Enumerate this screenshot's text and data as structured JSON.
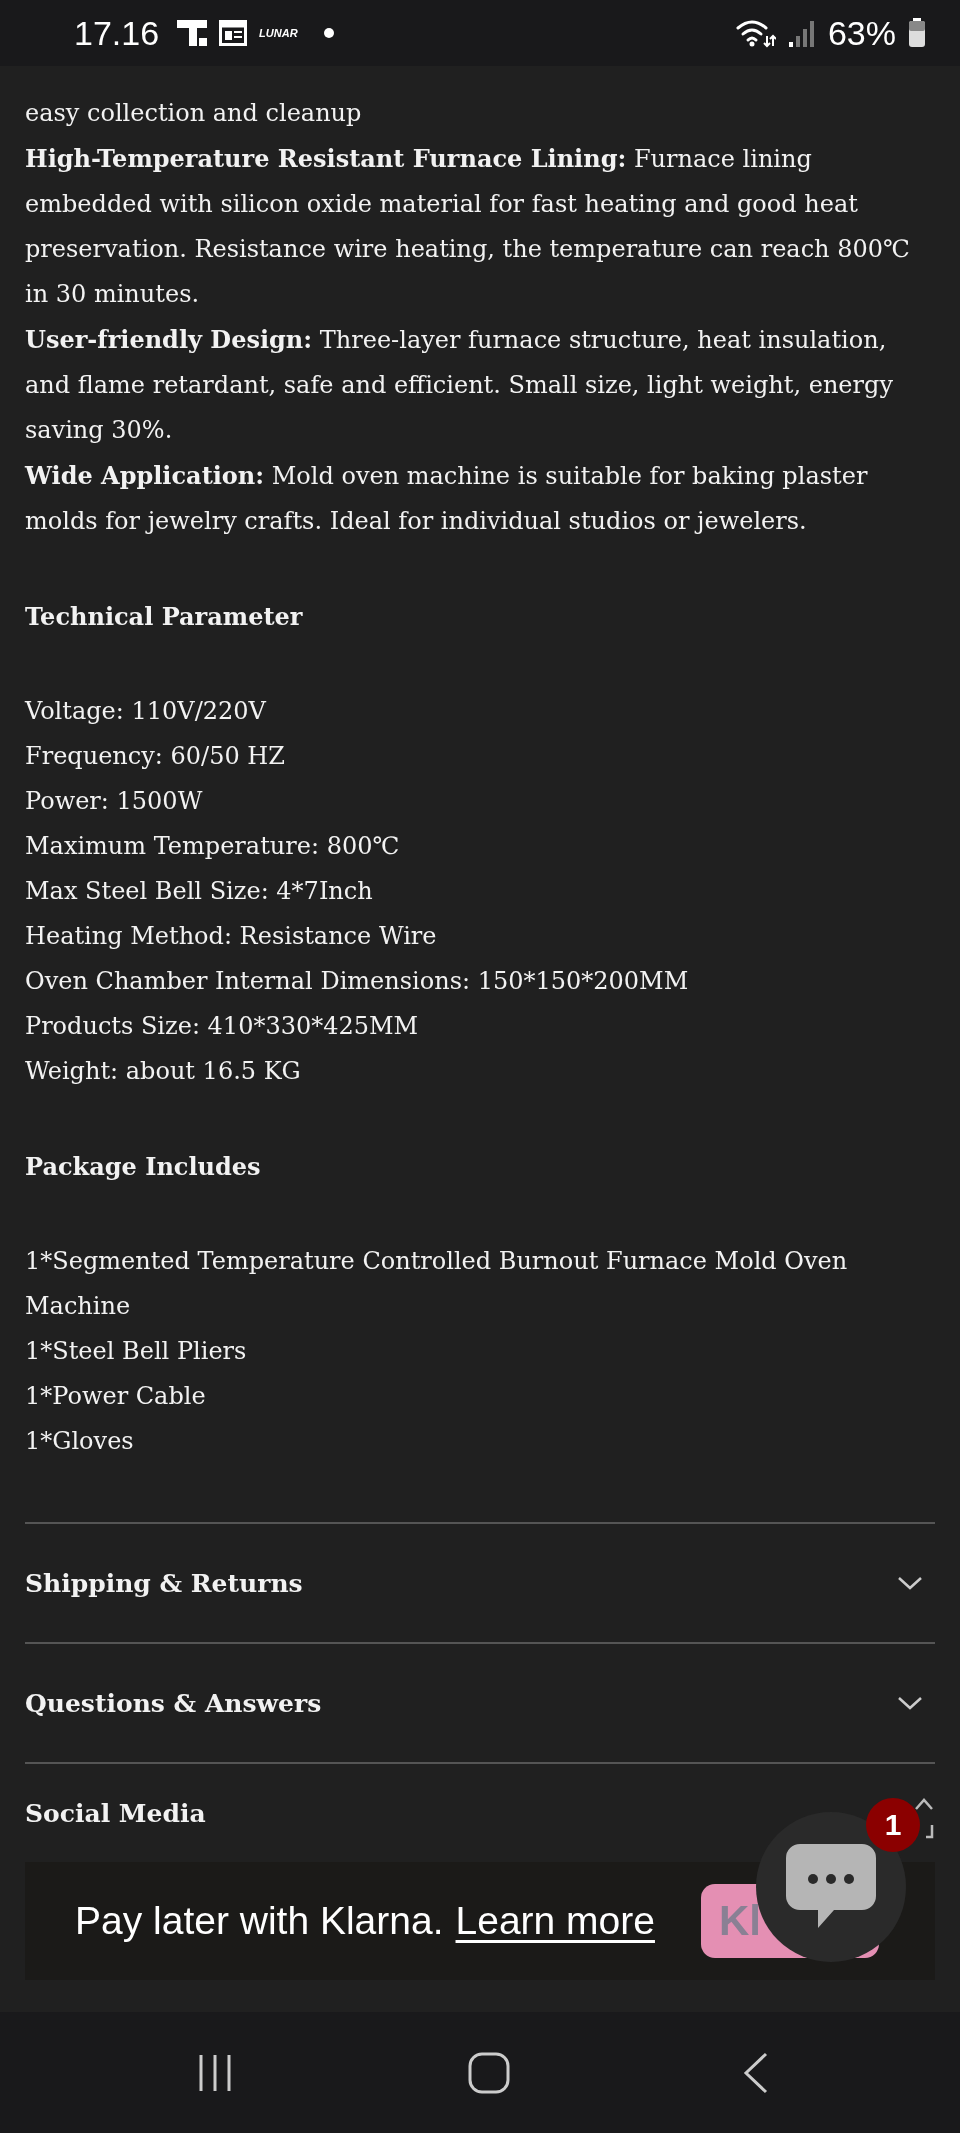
{
  "status_bar": {
    "time": "17.16",
    "app_label": "LUNAR",
    "battery": "63%"
  },
  "description": [
    {
      "text": "easy collection and cleanup"
    },
    {
      "text": "**High-Temperature Resistant Furnace Lining:** Furnace lining embedded with silicon oxide material for fast heating and good heat preservation. Resistance wire heating, the temperature can reach 800℃ in 30 minutes."
    },
    {
      "text": "**User-friendly Design:** Three-layer furnace structure, heat insulation, and flame retardant, safe and efficient. Small size, light weight, energy saving 30%."
    },
    {
      "text": "**Wide Application:** Mold oven machine is suitable for baking plaster molds for jewelry crafts. Ideal for individual studios or jewelers."
    }
  ],
  "sections": [
    {
      "heading": "Technical Parameter",
      "lines": [
        "Voltage: 110V/220V",
        "Frequency: 60/50 HZ",
        "Power: 1500W",
        "Maximum Temperature: 800℃",
        "Max Steel Bell Size: 4*7Inch",
        "Heating Method: Resistance Wire",
        "Oven Chamber Internal Dimensions: 150*150*200MM",
        "Products Size: 410*330*425MM",
        "Weight: about 16.5 KG"
      ]
    },
    {
      "heading": "Package Includes",
      "lines": [
        "1*Segmented Temperature Controlled Burnout Furnace Mold Oven Machine",
        "1*Steel Bell Pliers",
        "1*Power Cable",
        "1*Gloves"
      ]
    }
  ],
  "accordion": [
    {
      "title": "Shipping & Returns",
      "expanded": false
    },
    {
      "title": "Questions & Answers",
      "expanded": false
    },
    {
      "title": "Social Media"
    }
  ],
  "klarna": {
    "text": "Pay later with Klarna.",
    "link": "Learn more",
    "badge": "Kl"
  },
  "chat": {
    "badge": "1"
  }
}
